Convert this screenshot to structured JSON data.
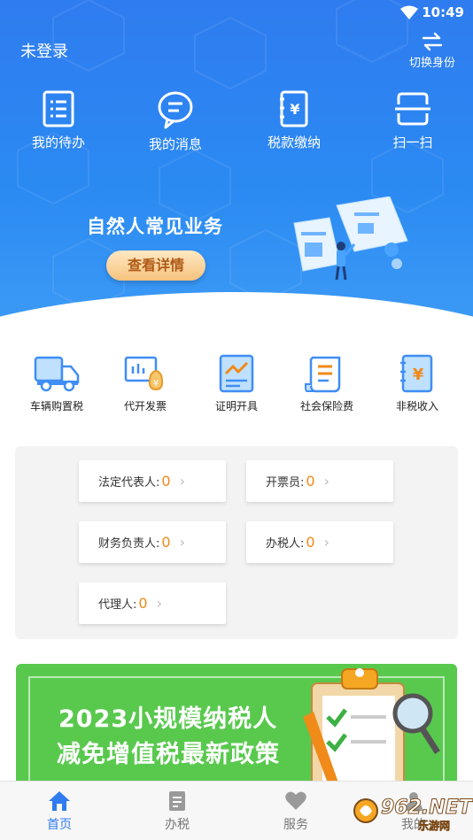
{
  "status_bar": {
    "time": "10:49"
  },
  "header": {
    "login_status": "未登录",
    "switch_identity_label": "切换身份",
    "quick_actions": [
      {
        "label": "我的待办",
        "icon": "todo-list-icon"
      },
      {
        "label": "我的消息",
        "icon": "chat-bubble-icon"
      },
      {
        "label": "税款缴纳",
        "icon": "tax-book-icon"
      },
      {
        "label": "扫一扫",
        "icon": "scan-icon"
      }
    ]
  },
  "banner": {
    "title": "自然人常见业务",
    "button_label": "查看详情"
  },
  "services": [
    {
      "label": "车辆购置税",
      "icon": "truck-icon"
    },
    {
      "label": "代开发票",
      "icon": "invoice-icon"
    },
    {
      "label": "证明开具",
      "icon": "certificate-chart-icon"
    },
    {
      "label": "社会保险费",
      "icon": "insurance-document-icon"
    },
    {
      "label": "非税收入",
      "icon": "non-tax-book-icon"
    }
  ],
  "roles": [
    {
      "label": "法定代表人:",
      "count": "0"
    },
    {
      "label": "开票员:",
      "count": "0"
    },
    {
      "label": "财务负责人:",
      "count": "0"
    },
    {
      "label": "办税人:",
      "count": "0"
    },
    {
      "label": "代理人:",
      "count": "0"
    }
  ],
  "promo": {
    "line1": "2023小规模纳税人",
    "line2": "减免增值税最新政策"
  },
  "bottom_nav": [
    {
      "label": "首页",
      "icon": "home-icon",
      "active": true
    },
    {
      "label": "办税",
      "icon": "document-icon",
      "active": false
    },
    {
      "label": "服务",
      "icon": "heart-icon",
      "active": false
    },
    {
      "label": "我的",
      "icon": "person-icon",
      "active": false
    }
  ],
  "watermark": {
    "brand": "962.NET",
    "sub": "乐游网"
  },
  "colors": {
    "primary": "#2f7cf0",
    "accent": "#f08a18",
    "promo_green": "#59c94e"
  }
}
